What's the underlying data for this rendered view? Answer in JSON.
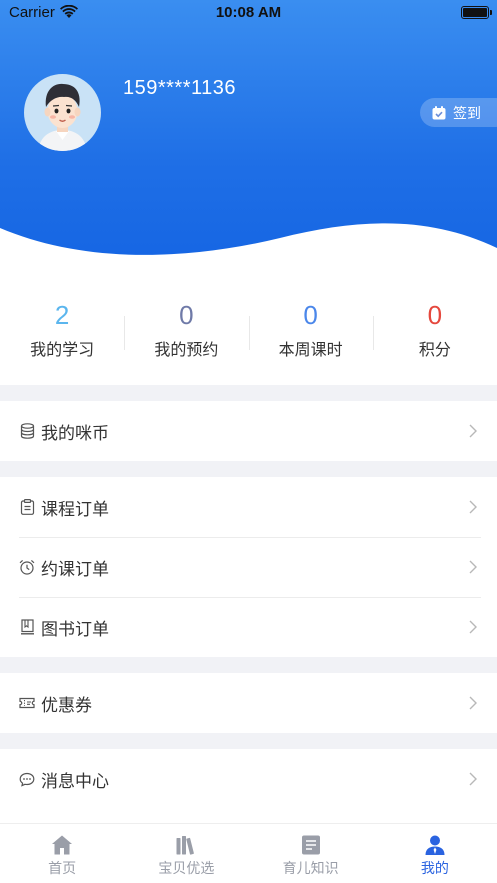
{
  "status_bar": {
    "carrier": "Carrier",
    "time": "10:08 AM"
  },
  "profile": {
    "phone": "159****1136",
    "checkin_label": "签到"
  },
  "colors": {
    "primary": "#1f6fe6",
    "accent_tab": "#2a63e0"
  },
  "stats": [
    {
      "value": "2",
      "label": "我的学习",
      "color": "#5bb6ee"
    },
    {
      "value": "0",
      "label": "我的预约",
      "color": "#6f7aa8"
    },
    {
      "value": "0",
      "label": "本周课时",
      "color": "#4b87ea"
    },
    {
      "value": "0",
      "label": "积分",
      "color": "#e5483d"
    }
  ],
  "menu": {
    "coins": {
      "label": "我的咪币",
      "icon": "coin-stack-icon"
    },
    "course_orders": {
      "label": "课程订单",
      "icon": "clipboard-icon"
    },
    "booking_orders": {
      "label": "约课订单",
      "icon": "alarm-clock-icon"
    },
    "book_orders": {
      "label": "图书订单",
      "icon": "book-icon"
    },
    "coupons": {
      "label": "优惠券",
      "icon": "ticket-icon"
    },
    "messages": {
      "label": "消息中心",
      "icon": "chat-bubble-icon"
    }
  },
  "tabbar": [
    {
      "label": "首页",
      "icon": "home-icon",
      "active": false
    },
    {
      "label": "宝贝优选",
      "icon": "books-icon",
      "active": false
    },
    {
      "label": "育儿知识",
      "icon": "document-icon",
      "active": false
    },
    {
      "label": "我的",
      "icon": "person-icon",
      "active": true
    }
  ]
}
